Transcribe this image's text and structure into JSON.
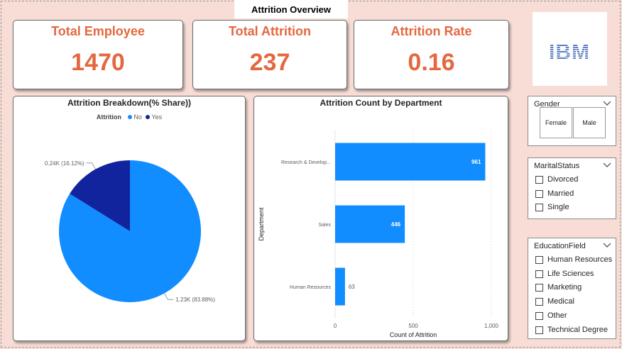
{
  "page_title": "Attrition Overview",
  "kpis": [
    {
      "title": "Total Employee",
      "value": "1470"
    },
    {
      "title": "Total Attrition",
      "value": "237"
    },
    {
      "title": "Attrition Rate",
      "value": "0.16"
    }
  ],
  "logo": {
    "text": "IBM",
    "color": "#5b7ec6"
  },
  "colors": {
    "accent": "#e3683f",
    "no": "#118dff",
    "yes": "#12239e",
    "background": "#f7ddd5"
  },
  "pie_panel": {
    "title": "Attrition Breakdown(% Share))",
    "legend_title": "Attrition",
    "legend": [
      {
        "label": "No"
      },
      {
        "label": "Yes"
      }
    ]
  },
  "bar_panel": {
    "title": "Attrition Count by Department"
  },
  "chart_data": [
    {
      "type": "pie",
      "title": "Attrition Breakdown(% Share))",
      "legend_title": "Attrition",
      "slices": [
        {
          "name": "No",
          "value": 1233,
          "label": "1.23K (83.88%)",
          "color": "#118dff"
        },
        {
          "name": "Yes",
          "value": 237,
          "label": "0.24K (16.12%)",
          "color": "#12239e"
        }
      ]
    },
    {
      "type": "bar",
      "orientation": "horizontal",
      "title": "Attrition Count by Department",
      "categories": [
        "Research & Develop...",
        "Sales",
        "Human Resources"
      ],
      "values": [
        961,
        446,
        63
      ],
      "data_labels": [
        "961",
        "446",
        "63"
      ],
      "xlabel": "Count of Attrition",
      "ylabel": "Department",
      "xlim": [
        0,
        1000
      ],
      "xticks": [
        "0",
        "500",
        "1,000"
      ],
      "color": "#118dff",
      "grid": true
    }
  ],
  "slicers": {
    "gender": {
      "title": "Gender",
      "options": [
        "Female",
        "Male"
      ]
    },
    "marital": {
      "title": "MaritalStatus",
      "options": [
        "Divorced",
        "Married",
        "Single"
      ]
    },
    "education": {
      "title": "EducationField",
      "options": [
        "Human Resources",
        "Life Sciences",
        "Marketing",
        "Medical",
        "Other",
        "Technical Degree"
      ]
    }
  }
}
